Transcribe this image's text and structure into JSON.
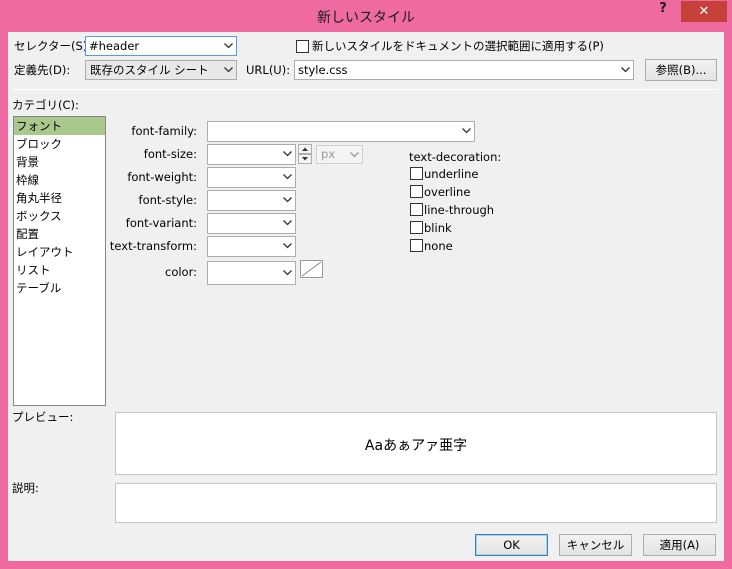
{
  "window": {
    "title": "新しいスタイル",
    "help": "?",
    "close": "✕"
  },
  "selector": {
    "label": "セレクター(S):",
    "value": "#header"
  },
  "apply_new": {
    "label": "新しいスタイルをドキュメントの選択範囲に適用する(P)",
    "checked": false
  },
  "define_in": {
    "label": "定義先(D):",
    "value": "既存のスタイル シート"
  },
  "url": {
    "label": "URL(U):",
    "value": "style.css"
  },
  "browse_label": "参照(B)...",
  "category": {
    "label": "カテゴリ(C):",
    "items": [
      "フォント",
      "ブロック",
      "背景",
      "枠線",
      "角丸半径",
      "ボックス",
      "配置",
      "レイアウト",
      "リスト",
      "テーブル"
    ],
    "selected_index": 0
  },
  "font_props": {
    "font_family": "font-family:",
    "font_size": "font-size:",
    "font_weight": "font-weight:",
    "font_style": "font-style:",
    "font_variant": "font-variant:",
    "text_transform": "text-transform:",
    "color": "color:",
    "unit": "px"
  },
  "text_decoration": {
    "label": "text-decoration:",
    "options": [
      "underline",
      "overline",
      "line-through",
      "blink",
      "none"
    ]
  },
  "preview": {
    "label": "プレビュー:",
    "sample": "Aaあぁアァ亜字"
  },
  "description": {
    "label": "説明:"
  },
  "buttons": {
    "ok": "OK",
    "cancel": "キャンセル",
    "apply": "適用(A)"
  },
  "colors": {
    "titlebar": "#f06aa2",
    "close": "#c7413b",
    "selection": "#a8c98b",
    "dialog": "#f0f0f0"
  }
}
